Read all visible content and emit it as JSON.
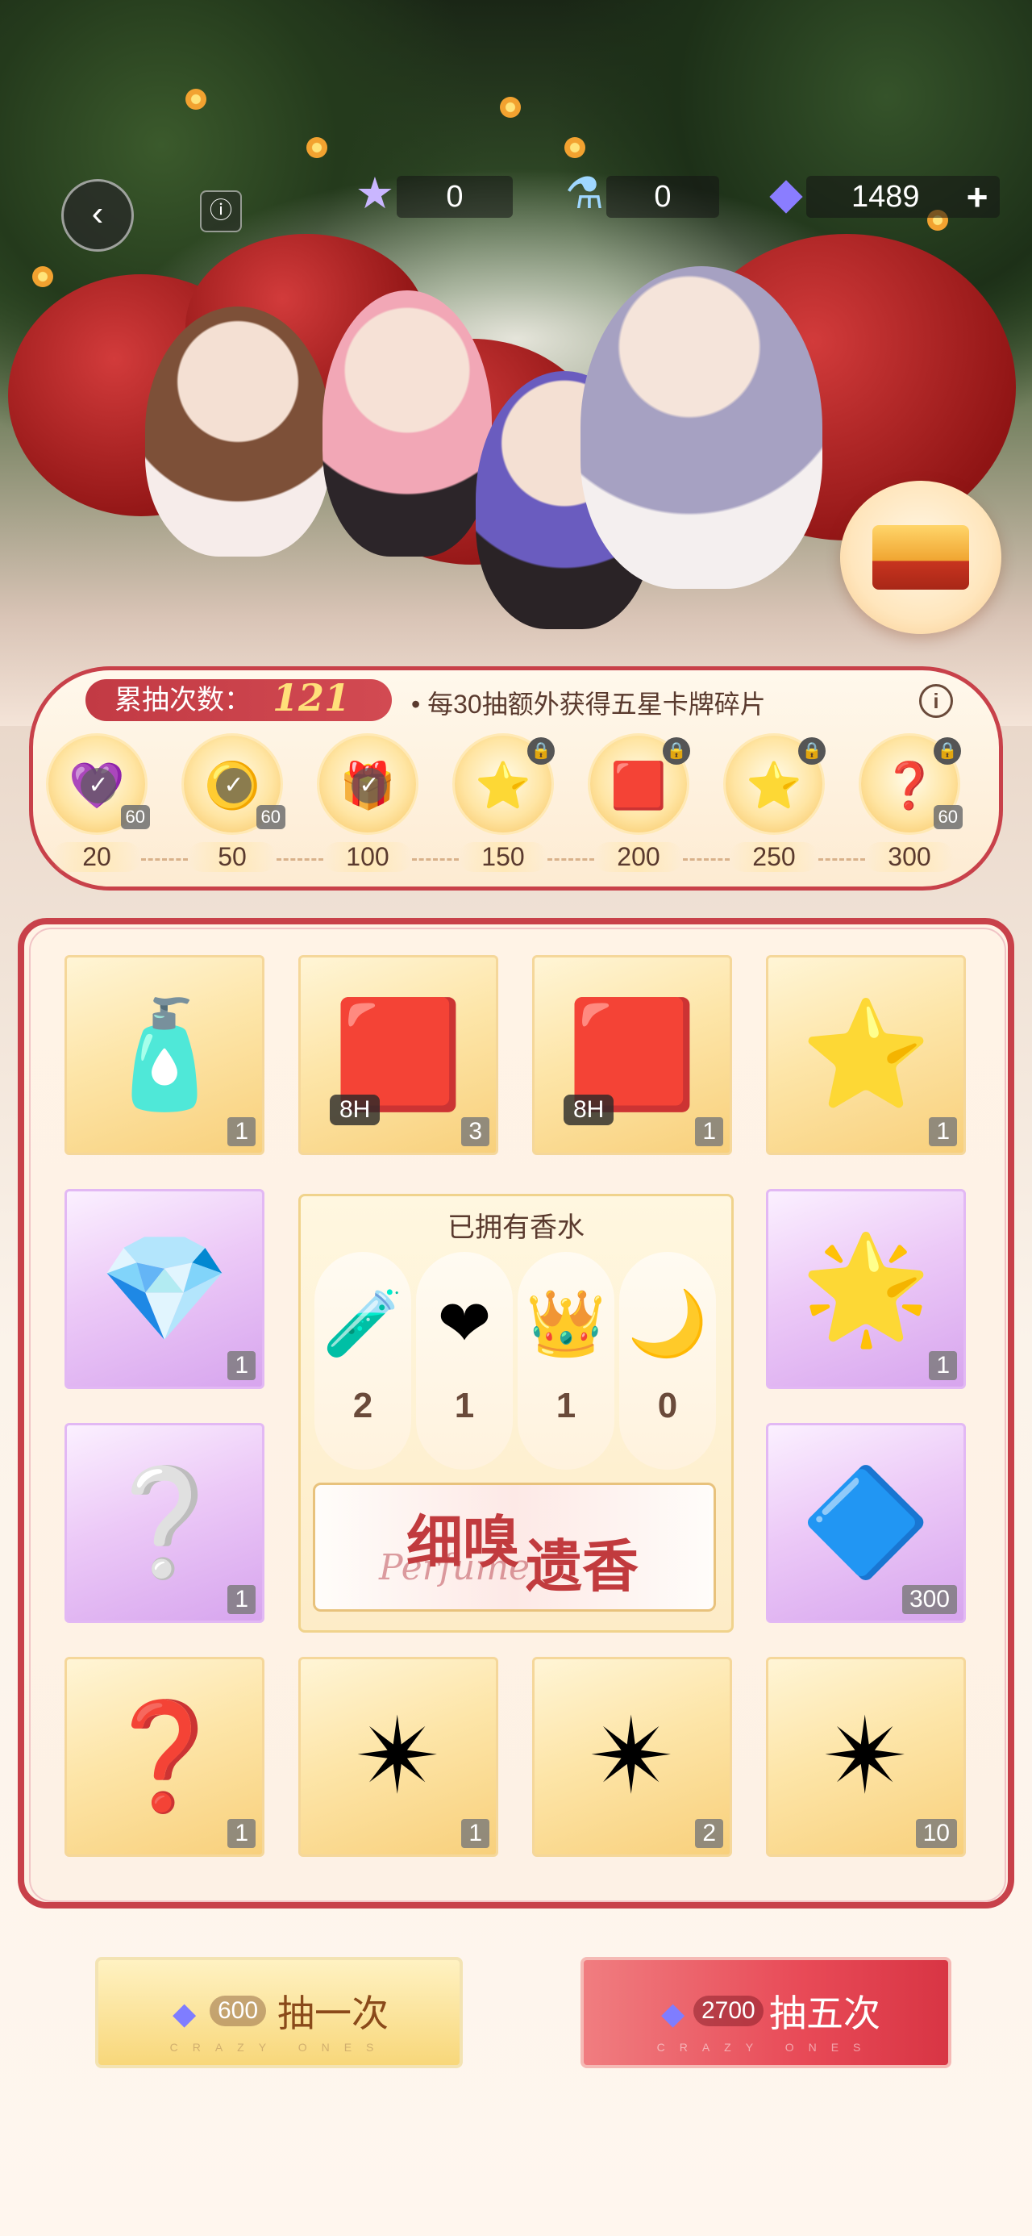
{
  "topbar": {
    "back_icon": "back-arrow-icon",
    "star_count": "0",
    "potion_count": "0",
    "diamond_count": "1489",
    "plus_label": "+"
  },
  "accumulate": {
    "label": "累抽次数：",
    "count": "121",
    "hint": "• 每30抽额外获得五星卡牌碎片",
    "info_label": "i",
    "rewards": [
      {
        "tier": "20",
        "icon": "purple-gem-icon",
        "glyph": "💜",
        "qty": "60",
        "claimed": true,
        "locked": false
      },
      {
        "tier": "50",
        "icon": "gold-coin-icon",
        "glyph": "🟡",
        "qty": "60",
        "claimed": true,
        "locked": false
      },
      {
        "tier": "100",
        "icon": "black-box-icon",
        "glyph": "🎁",
        "qty": "",
        "claimed": true,
        "locked": false
      },
      {
        "tier": "150",
        "icon": "star-icon",
        "glyph": "⭐",
        "qty": "",
        "claimed": false,
        "locked": true
      },
      {
        "tier": "200",
        "icon": "red-card-box-icon",
        "glyph": "🟥",
        "qty": "",
        "claimed": false,
        "locked": true
      },
      {
        "tier": "250",
        "icon": "star-icon",
        "glyph": "⭐",
        "qty": "",
        "claimed": false,
        "locked": true
      },
      {
        "tier": "300",
        "icon": "mystery-gold-icon",
        "glyph": "❓",
        "qty": "60",
        "claimed": false,
        "locked": true
      }
    ]
  },
  "pool": {
    "cards": [
      {
        "name": "mystery-perfume-card",
        "style": "gold",
        "glyph": "🧴",
        "qty": "1",
        "timer": ""
      },
      {
        "name": "red-cube-card",
        "style": "gold",
        "glyph": "🟥",
        "qty": "3",
        "timer": "8H"
      },
      {
        "name": "red-cube-card",
        "style": "gold",
        "glyph": "🟥",
        "qty": "1",
        "timer": "8H"
      },
      {
        "name": "star-card",
        "style": "gold",
        "glyph": "⭐",
        "qty": "1",
        "timer": ""
      },
      {
        "name": "diamond-box-card",
        "style": "purple",
        "glyph": "💎",
        "qty": "1",
        "timer": ""
      },
      {
        "name": "gold-star-medal-card",
        "style": "purple",
        "glyph": "🌟",
        "qty": "1",
        "timer": ""
      },
      {
        "name": "purple-mystery-card",
        "style": "purple",
        "glyph": "❔",
        "qty": "1",
        "timer": ""
      },
      {
        "name": "blue-crystal-card",
        "style": "purple",
        "glyph": "🔷",
        "qty": "300",
        "timer": ""
      },
      {
        "name": "gold-mystery-card",
        "style": "gold",
        "glyph": "❓",
        "qty": "1",
        "timer": ""
      },
      {
        "name": "rainbow-star-card",
        "style": "gold",
        "glyph": "✴",
        "qty": "1",
        "timer": ""
      },
      {
        "name": "rainbow-star-card",
        "style": "gold",
        "glyph": "✴",
        "qty": "2",
        "timer": ""
      },
      {
        "name": "rainbow-star-card",
        "style": "gold",
        "glyph": "✴",
        "qty": "10",
        "timer": ""
      }
    ],
    "owned": {
      "title": "已拥有香水",
      "perfumes": [
        {
          "icon": "teal-bag-perfume-icon",
          "glyph": "🧪",
          "count": "2"
        },
        {
          "icon": "red-heart-perfume-icon",
          "glyph": "❤",
          "count": "1"
        },
        {
          "icon": "gold-crown-perfume-icon",
          "glyph": "👑",
          "count": "1"
        },
        {
          "icon": "purple-moon-perfume-icon",
          "glyph": "🌙",
          "count": "0"
        }
      ],
      "banner_line1": "细嗅",
      "banner_line2": "遗香",
      "banner_sub": "Perfume"
    }
  },
  "draw": {
    "one": {
      "cost": "600",
      "label": "抽一次",
      "tag": "CRAZY ONES"
    },
    "five": {
      "cost": "2700",
      "label": "抽五次",
      "tag": "CRAZY ONES"
    }
  },
  "colors": {
    "accent_red": "#c8414a",
    "gold": "#f8d07c",
    "purple": "#d7a5ee"
  }
}
